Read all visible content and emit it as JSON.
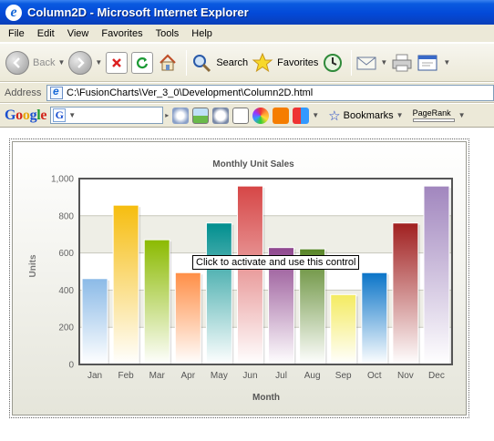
{
  "window": {
    "title": "Column2D - Microsoft Internet Explorer"
  },
  "menu": [
    "File",
    "Edit",
    "View",
    "Favorites",
    "Tools",
    "Help"
  ],
  "toolbar": {
    "back_label": "Back",
    "search_label": "Search",
    "favorites_label": "Favorites"
  },
  "address": {
    "label": "Address",
    "url": "C:\\FusionCharts\\Ver_3_0\\Development\\Column2D.html"
  },
  "google": {
    "logo": "Google",
    "search_mini": "G",
    "bookmarks_label": "Bookmarks",
    "pagerank_label": "PageRank"
  },
  "tooltip": "Click to activate and use this control",
  "colors": {
    "titlebar": "#0349d8",
    "chrome": "#ece9d8"
  },
  "chart_data": {
    "type": "bar",
    "title": "Monthly Unit Sales",
    "xlabel": "Month",
    "ylabel": "Units",
    "categories": [
      "Jan",
      "Feb",
      "Mar",
      "Apr",
      "May",
      "Jun",
      "Jul",
      "Aug",
      "Sep",
      "Oct",
      "Nov",
      "Dec"
    ],
    "values": [
      462,
      857,
      671,
      494,
      761,
      960,
      629,
      622,
      376,
      494,
      761,
      960
    ],
    "yticks": [
      "0",
      "200",
      "400",
      "600",
      "800",
      "1,000"
    ],
    "ylim": [
      0,
      1000
    ],
    "grid": true,
    "colors": [
      "#8BBAE7",
      "#F6BD0F",
      "#8BBA00",
      "#FF8E46",
      "#008E8E",
      "#D64646",
      "#8E468E",
      "#588526",
      "#F4EB60",
      "#0A74C8",
      "#A01F1F",
      "#A186BE"
    ]
  }
}
